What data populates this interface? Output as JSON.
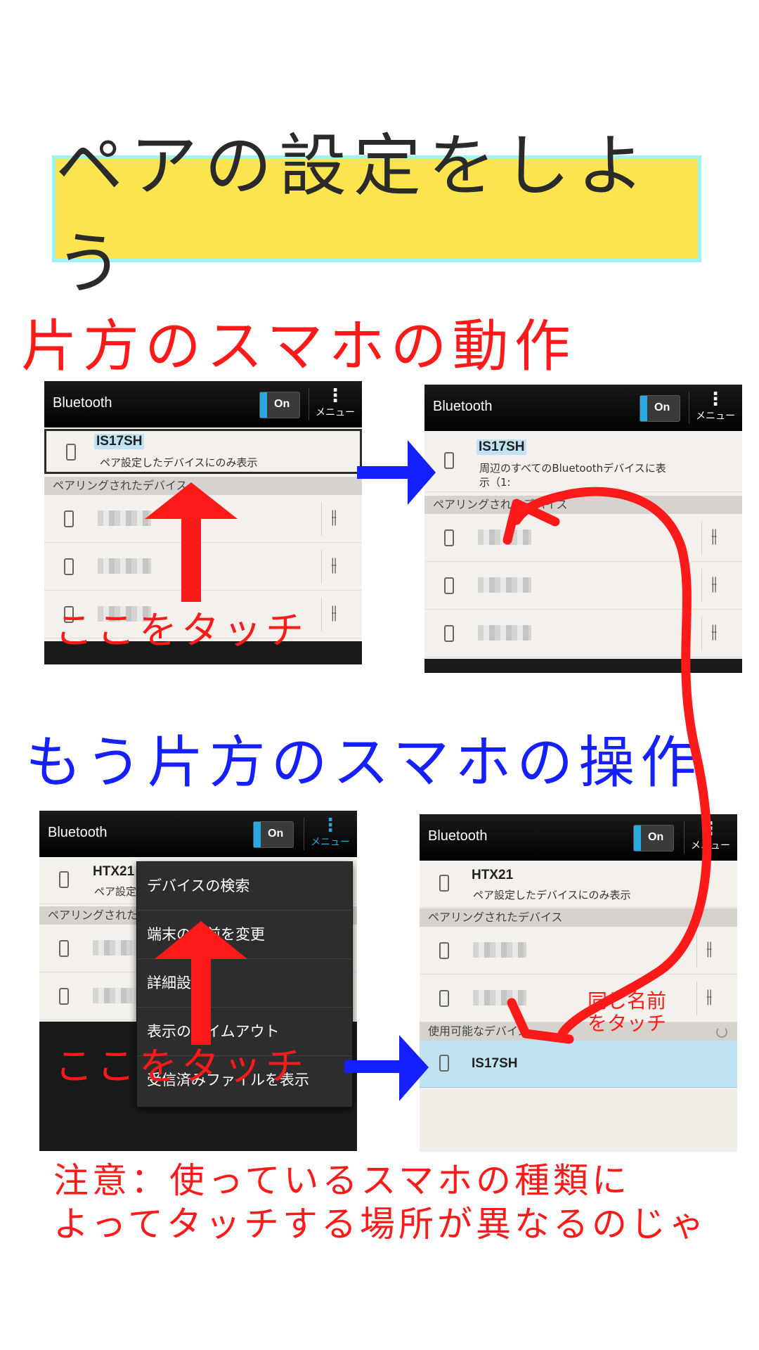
{
  "title": "ペアの設定をしよう",
  "section1_heading": "片方のスマホの動作",
  "section2_heading": "もう片方のスマホの操作",
  "touch_here": "ここをタッチ",
  "same_name_touch": [
    "同じ名前",
    "をタッチ"
  ],
  "note_lines": [
    "注意：使っているスマホの種類に",
    "よってタッチする場所が異なるのじゃ"
  ],
  "colors": {
    "accent_red": "#ff1a1a",
    "accent_blue": "#1520ff",
    "banner": "#fbe44e",
    "toggle": "#29a9e1"
  },
  "phone": {
    "app_title": "Bluetooth",
    "toggle_label": "On",
    "menu_label": "メニュー",
    "paired_header": "ペアリングされたデバイス",
    "available_header": "使用可能なデバイス"
  },
  "screen1": {
    "device_name": "IS17SH",
    "device_sub": "ペア設定したデバイスにのみ表示"
  },
  "screen2": {
    "device_name": "IS17SH",
    "device_sub_line1": "周辺のすべてのBluetoothデバイスに表",
    "device_sub_line2": "示（1:"
  },
  "screen3": {
    "device_name": "HTX21",
    "device_sub": "ペア設定",
    "menu_items": [
      "デバイスの検索",
      "端末の名前を変更",
      "詳細設定",
      "表示のタイムアウト",
      "受信済みファイルを表示"
    ]
  },
  "screen4": {
    "device_name": "HTX21",
    "device_sub": "ペア設定したデバイスにのみ表示",
    "available_device": "IS17SH"
  },
  "icons": [
    "phone-icon",
    "sliders-icon",
    "overflow-menu-icon",
    "spinner-icon",
    "arrow-right-icon",
    "arrow-up-icon"
  ]
}
